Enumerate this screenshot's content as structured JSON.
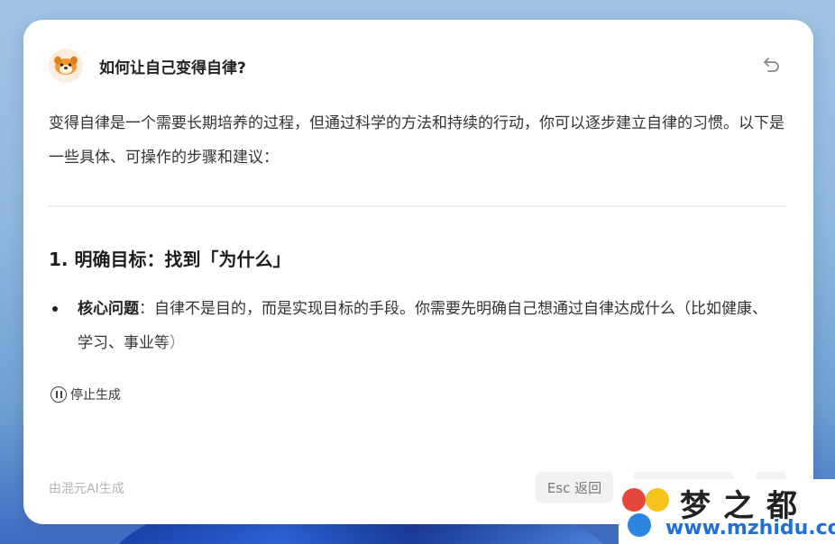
{
  "dialog": {
    "question": "如何让自己变得自律?",
    "intro": "变得自律是一个需要长期培养的过程，但通过科学的方法和持续的行动，你可以逐步建立自律的习惯。以下是一些具体、可操作的步骤和建议：",
    "section_heading": "1. 明确目标：找到「为什么」",
    "bullet": {
      "label": "核心问题",
      "separator": "：",
      "text": "自律不是目的，而是实现目标的手段。你需要先明确自己想通过自律达成什么（比如健康、学习、",
      "fading_text": "事业等）"
    },
    "stop_label": "停止生成",
    "footer_note": "由混元AI生成",
    "esc_label": "Esc 返回"
  },
  "icons": {
    "avatar": "hunyuan-dog-avatar-icon",
    "undo": "undo-icon",
    "stop": "pause-circle-icon"
  },
  "watermark": {
    "brand": "梦之都",
    "url": "www.mzhidu.com"
  },
  "colors": {
    "accent_url": "#1f6fd6",
    "card_bg": "#ffffff"
  }
}
